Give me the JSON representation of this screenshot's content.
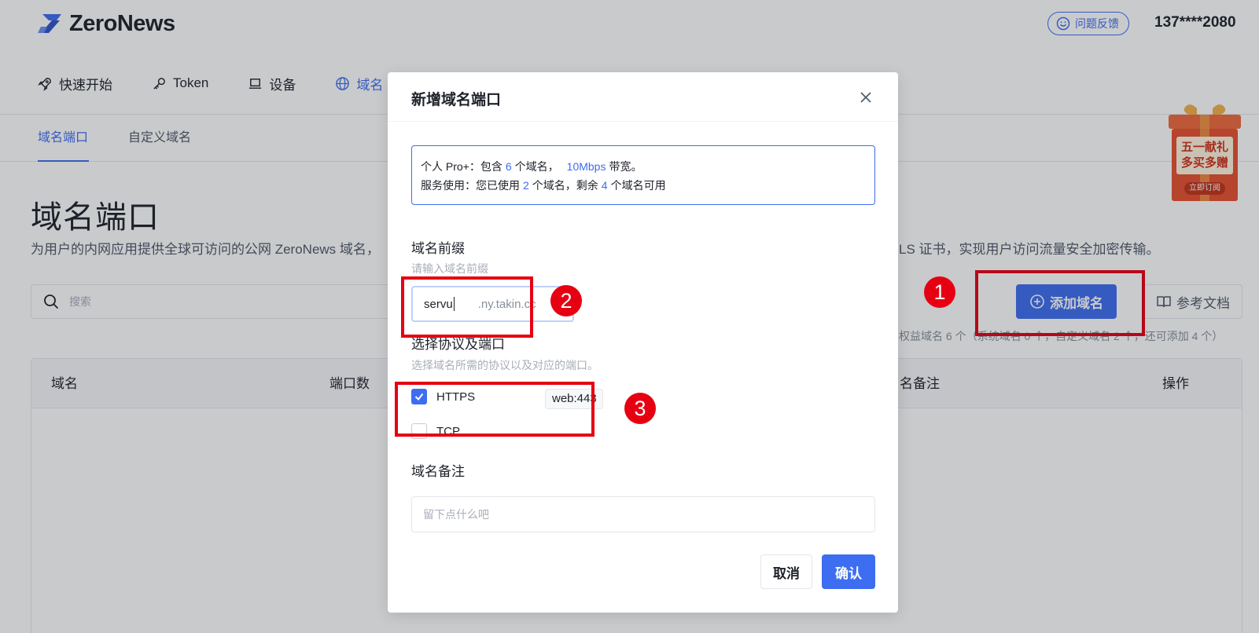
{
  "header": {
    "brand": "ZeroNews",
    "feedback_label": "问题反馈",
    "user_phone": "137****2080"
  },
  "main_nav": [
    {
      "label": "快速开始",
      "icon": "rocket-icon"
    },
    {
      "label": "Token",
      "icon": "key-icon"
    },
    {
      "label": "设备",
      "icon": "laptop-icon"
    },
    {
      "label": "域名",
      "icon": "globe-icon"
    }
  ],
  "sub_nav": [
    {
      "label": "域名端口",
      "active": true
    },
    {
      "label": "自定义域名",
      "active": false
    }
  ],
  "page": {
    "title": "域名端口",
    "description_left": "为用户的内网应用提供全球可访问的公网 ZeroNews 域名，",
    "description_right": "LS 证书，实现用户访问流量安全加密传输。",
    "search_placeholder": "搜索",
    "add_domain_label": "添加域名",
    "docs_label": "参考文档",
    "quota_note": "权益域名 6 个（系统域名 0 个，自定义域名 2 个，还可添加 4 个）",
    "table_headers": [
      "域名",
      "端口数",
      "名备注",
      "操作"
    ]
  },
  "promo": {
    "line1": "五一献礼",
    "line2": "多买多赠",
    "button": "立即订阅"
  },
  "modal": {
    "title": "新增域名端口",
    "plan": {
      "prefix": "个人 Pro+：包含",
      "domains_included": "6",
      "mid": "个域名，",
      "bandwidth": "10Mbps",
      "suffix": "带宽。"
    },
    "usage": {
      "prefix": "服务使用：您已使用",
      "used": "2",
      "mid": "个域名，剩余",
      "remaining": "4",
      "suffix": "个域名可用"
    },
    "prefix_field": {
      "label": "域名前缀",
      "hint": "请输入域名前缀",
      "value": "servu",
      "suffix": ".ny.takin.cc"
    },
    "protocol_field": {
      "label": "选择协议及端口",
      "hint": "选择域名所需的协议以及对应的端口。",
      "options": [
        {
          "label": "HTTPS",
          "checked": true,
          "port": "web:443"
        },
        {
          "label": "TCP",
          "checked": false
        }
      ]
    },
    "note_field": {
      "label": "域名备注",
      "placeholder": "留下点什么吧"
    },
    "cancel_label": "取消",
    "confirm_label": "确认"
  },
  "annotations": [
    "1",
    "2",
    "3"
  ],
  "colors": {
    "accent": "#3d6df0",
    "annotation": "#e60012",
    "promo": "#e8502f"
  }
}
